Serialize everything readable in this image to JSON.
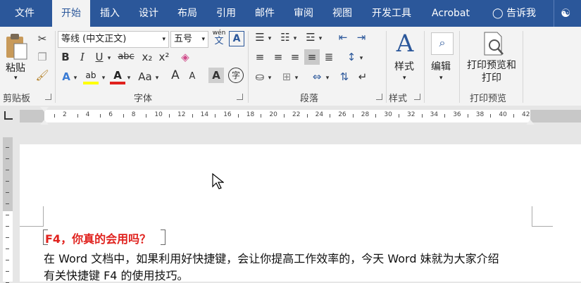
{
  "tabs": [
    "文件",
    "开始",
    "插入",
    "设计",
    "布局",
    "引用",
    "邮件",
    "审阅",
    "视图",
    "开发工具",
    "Acrobat"
  ],
  "tell_me": "告诉我",
  "clipboard": {
    "paste": "粘贴",
    "label": "剪贴板"
  },
  "font": {
    "name": "等线 (中文正文)",
    "size": "五号",
    "label": "字体",
    "wen_top": "wén",
    "wen_bottom": "文",
    "bold": "B",
    "italic": "I",
    "underline": "U",
    "strike": "abc",
    "sub": "x₂",
    "sup": "x²",
    "grow": "A",
    "shrink": "A",
    "case": "Aa",
    "char_shade": "A",
    "circle": "字"
  },
  "paragraph": {
    "label": "段落"
  },
  "styles": {
    "btn": "样式",
    "label": "样式"
  },
  "editing": {
    "btn": "编辑"
  },
  "print_preview": {
    "btn_line1": "打印预览和",
    "btn_line2": "打印",
    "label": "打印预览"
  },
  "ruler": {
    "ticks": [
      "2",
      "4",
      "6",
      "8",
      "10",
      "12",
      "14",
      "16",
      "18",
      "20",
      "22",
      "24",
      "26",
      "28",
      "30",
      "32",
      "34",
      "36",
      "38",
      "40",
      "42"
    ]
  },
  "document": {
    "heading": "F4，你真的会用吗？",
    "line1": "在 Word 文档中，如果利用好快捷键，会让你提高工作效率的，今天 Word 妹就为大家介绍",
    "line2": "有关快捷键 F4 的使用技巧。"
  },
  "colors": {
    "brand": "#2b579a",
    "heading": "#e0211d",
    "highlight": "#ffff00",
    "font_color": "#e0211d"
  }
}
